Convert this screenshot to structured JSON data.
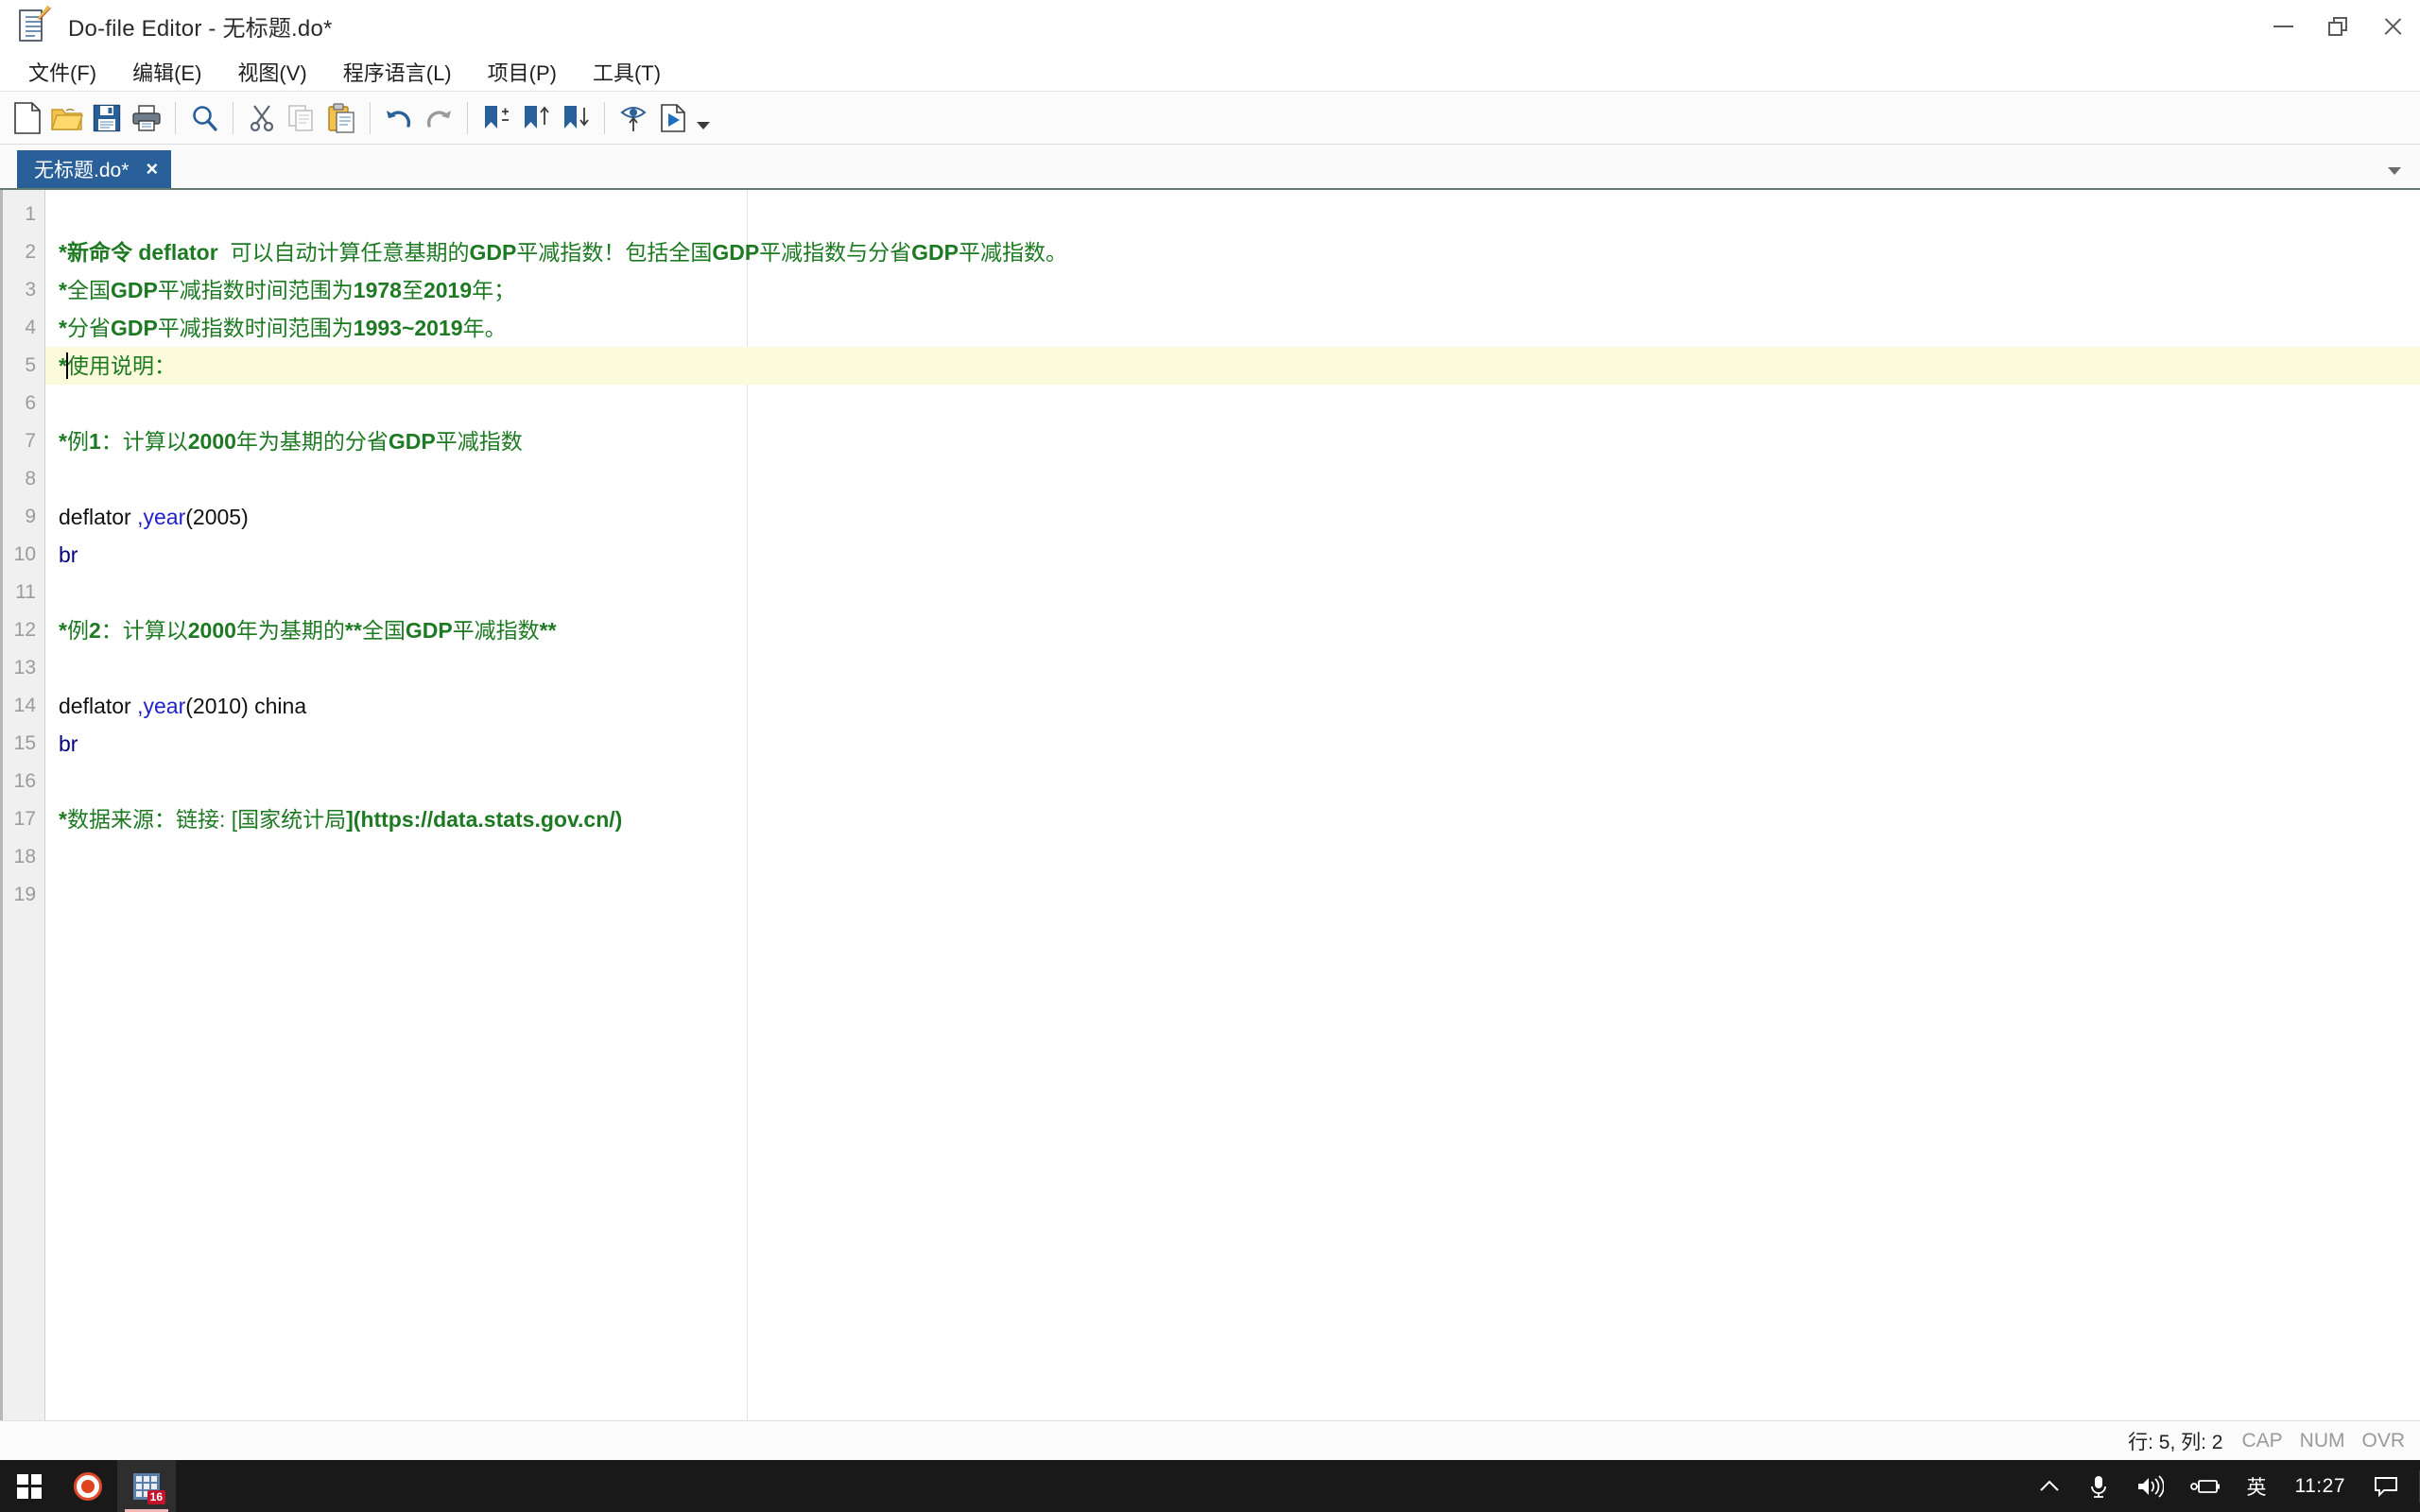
{
  "window": {
    "title": "Do-file Editor - 无标题.do*",
    "icon": "document-edit-icon",
    "controls": {
      "minimize": "minimize-icon",
      "restore": "restore-icon",
      "close": "close-icon"
    }
  },
  "menubar": {
    "items": [
      {
        "label": "文件(F)",
        "name": "menu-file"
      },
      {
        "label": "编辑(E)",
        "name": "menu-edit"
      },
      {
        "label": "视图(V)",
        "name": "menu-view"
      },
      {
        "label": "程序语言(L)",
        "name": "menu-language"
      },
      {
        "label": "项目(P)",
        "name": "menu-project"
      },
      {
        "label": "工具(T)",
        "name": "menu-tools"
      }
    ]
  },
  "toolbar": {
    "buttons": [
      {
        "name": "new-file-icon",
        "tooltip": "新建"
      },
      {
        "name": "open-folder-icon",
        "tooltip": "打开"
      },
      {
        "name": "save-icon",
        "tooltip": "保存"
      },
      {
        "name": "print-icon",
        "tooltip": "打印"
      },
      {
        "name": "find-icon",
        "tooltip": "查找"
      },
      {
        "name": "cut-icon",
        "tooltip": "剪切"
      },
      {
        "name": "copy-icon",
        "tooltip": "复制"
      },
      {
        "name": "paste-icon",
        "tooltip": "粘贴"
      },
      {
        "name": "undo-icon",
        "tooltip": "撤销"
      },
      {
        "name": "redo-icon",
        "tooltip": "重做"
      },
      {
        "name": "bookmark-toggle-icon",
        "tooltip": "切换书签"
      },
      {
        "name": "bookmark-prev-icon",
        "tooltip": "上一个书签"
      },
      {
        "name": "bookmark-next-icon",
        "tooltip": "下一个书签"
      },
      {
        "name": "preview-icon",
        "tooltip": "预览"
      },
      {
        "name": "run-icon",
        "tooltip": "执行"
      }
    ],
    "overflow_caret": "chevron-down-icon"
  },
  "tabs": {
    "items": [
      {
        "label": "无标题.do*",
        "close": "×",
        "active": true
      }
    ],
    "list_caret": "chevron-down-icon"
  },
  "editor": {
    "current_line": 5,
    "margin_guide_column": true,
    "lines": [
      {
        "num": "1",
        "tokens": []
      },
      {
        "num": "2",
        "tokens": [
          {
            "t": "comment",
            "v": "*新命令 deflator  "
          },
          {
            "t": "comment-cjk",
            "v": "可以自动计算任意基期的"
          },
          {
            "t": "comment",
            "v": "GDP"
          },
          {
            "t": "comment-cjk",
            "v": "平减指数！包括全国"
          },
          {
            "t": "comment",
            "v": "GDP"
          },
          {
            "t": "comment-cjk",
            "v": "平减指数与分省"
          },
          {
            "t": "comment",
            "v": "GDP"
          },
          {
            "t": "comment-cjk",
            "v": "平减指数。"
          }
        ]
      },
      {
        "num": "3",
        "tokens": [
          {
            "t": "comment",
            "v": "*"
          },
          {
            "t": "comment-cjk",
            "v": "全国"
          },
          {
            "t": "comment",
            "v": "GDP"
          },
          {
            "t": "comment-cjk",
            "v": "平减指数时间范围为"
          },
          {
            "t": "comment",
            "v": "1978"
          },
          {
            "t": "comment-cjk",
            "v": "至"
          },
          {
            "t": "comment",
            "v": "2019"
          },
          {
            "t": "comment-cjk",
            "v": "年；"
          }
        ]
      },
      {
        "num": "4",
        "tokens": [
          {
            "t": "comment",
            "v": "*"
          },
          {
            "t": "comment-cjk",
            "v": "分省"
          },
          {
            "t": "comment",
            "v": "GDP"
          },
          {
            "t": "comment-cjk",
            "v": "平减指数时间范围为"
          },
          {
            "t": "comment",
            "v": "1993~2019"
          },
          {
            "t": "comment-cjk",
            "v": "年。"
          }
        ]
      },
      {
        "num": "5",
        "tokens": [
          {
            "t": "comment",
            "v": "*"
          },
          {
            "t": "caret",
            "v": ""
          },
          {
            "t": "comment-cjk",
            "v": "使用说明："
          }
        ]
      },
      {
        "num": "6",
        "tokens": []
      },
      {
        "num": "7",
        "tokens": [
          {
            "t": "comment",
            "v": "*"
          },
          {
            "t": "comment-cjk",
            "v": "例"
          },
          {
            "t": "comment",
            "v": "1"
          },
          {
            "t": "comment-cjk",
            "v": "：计算以"
          },
          {
            "t": "comment",
            "v": "2000"
          },
          {
            "t": "comment-cjk",
            "v": "年为基期的分省"
          },
          {
            "t": "comment",
            "v": "GDP"
          },
          {
            "t": "comment-cjk",
            "v": "平减指数"
          }
        ]
      },
      {
        "num": "8",
        "tokens": []
      },
      {
        "num": "9",
        "tokens": [
          {
            "t": "plain",
            "v": "deflator "
          },
          {
            "t": "kw",
            "v": ",year"
          },
          {
            "t": "plain",
            "v": "(2005)"
          }
        ]
      },
      {
        "num": "10",
        "tokens": [
          {
            "t": "cmd",
            "v": "br"
          }
        ]
      },
      {
        "num": "11",
        "tokens": []
      },
      {
        "num": "12",
        "tokens": [
          {
            "t": "comment",
            "v": "*"
          },
          {
            "t": "comment-cjk",
            "v": "例"
          },
          {
            "t": "comment",
            "v": "2"
          },
          {
            "t": "comment-cjk",
            "v": "：计算以"
          },
          {
            "t": "comment",
            "v": "2000"
          },
          {
            "t": "comment-cjk",
            "v": "年为基期的"
          },
          {
            "t": "comment",
            "v": "**"
          },
          {
            "t": "comment-cjk",
            "v": "全国"
          },
          {
            "t": "comment",
            "v": "GDP"
          },
          {
            "t": "comment-cjk",
            "v": "平减指数"
          },
          {
            "t": "comment",
            "v": "**"
          }
        ]
      },
      {
        "num": "13",
        "tokens": []
      },
      {
        "num": "14",
        "tokens": [
          {
            "t": "plain",
            "v": "deflator "
          },
          {
            "t": "kw",
            "v": ",year"
          },
          {
            "t": "plain",
            "v": "(2010) china"
          }
        ]
      },
      {
        "num": "15",
        "tokens": [
          {
            "t": "cmd",
            "v": "br"
          }
        ]
      },
      {
        "num": "16",
        "tokens": []
      },
      {
        "num": "17",
        "tokens": [
          {
            "t": "comment",
            "v": "*"
          },
          {
            "t": "comment-cjk",
            "v": "数据来源："
          },
          {
            "t": "comment-cjk",
            "v": "链接: ["
          },
          {
            "t": "comment-cjk",
            "v": "国家统计局"
          },
          {
            "t": "comment",
            "v": "](https://data.stats.gov.cn/)"
          }
        ]
      },
      {
        "num": "18",
        "tokens": []
      },
      {
        "num": "19",
        "tokens": []
      }
    ]
  },
  "statusbar": {
    "position": "行: 5, 列: 2",
    "flags": [
      "CAP",
      "NUM",
      "OVR"
    ]
  },
  "taskbar": {
    "start": "windows-start-icon",
    "apps": [
      {
        "name": "stata-app-icon",
        "badge": ""
      },
      {
        "name": "grid-app-icon",
        "badge": "16"
      }
    ],
    "tray": {
      "overflow": "chevron-up-icon",
      "microphone": "microphone-icon",
      "volume": "speaker-icon",
      "battery": "battery-charging-icon",
      "ime": "英",
      "clock": "11:27",
      "notifications": "notification-icon"
    }
  },
  "colors": {
    "tab_active_bg": "#2a6099",
    "comment_green": "#1d7a22",
    "keyword_blue": "#2222cc",
    "command_navy": "#00007f",
    "current_line_bg": "#fbfbdc",
    "taskbar_bg": "#191919"
  }
}
